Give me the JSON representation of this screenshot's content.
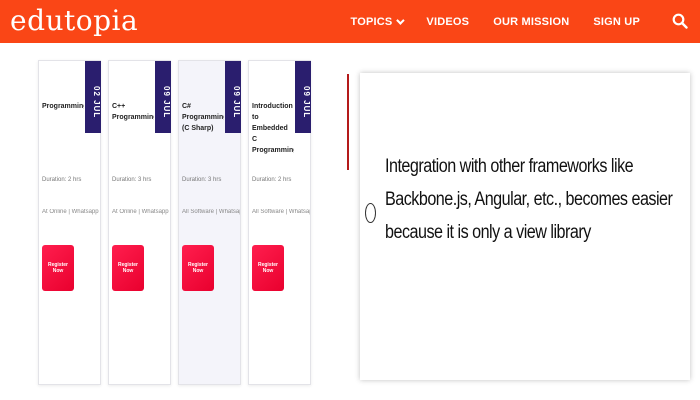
{
  "header": {
    "logo": "edutopia",
    "nav": [
      {
        "label": "TOPICS",
        "has_dropdown": true
      },
      {
        "label": "VIDEOS"
      },
      {
        "label": "OUR MISSION"
      },
      {
        "label": "SIGN UP"
      }
    ],
    "search_icon": "search-icon",
    "bg_color": "#fa4616"
  },
  "cards": [
    {
      "number": "02 JUL",
      "title": "Programming",
      "meta1": "Duration: 2 hrs",
      "meta2": "At Online | Whatsapp & Hardcopy",
      "cta": "Register Now"
    },
    {
      "number": "09 JUL",
      "title": "C++ Programming",
      "meta1": "Duration: 3 hrs",
      "meta2": "At Online | Whatsapp & Hardcopy",
      "cta": "Register Now"
    },
    {
      "number": "09 JUL",
      "title": "C# Programming (C Sharp)",
      "meta1": "Duration: 3 hrs",
      "meta2": "All Software | Whatsapp & Hardcopy",
      "cta": "Register Now"
    },
    {
      "number": "09 JUL",
      "title": "Introduction to Embedded C Programming",
      "meta1": "Duration: 2 hrs",
      "meta2": "All Software | Whatsapp & Hardcopy",
      "cta": "Register Now"
    }
  ],
  "quote": {
    "text": "Integration with other frameworks like Backbone.js, Angular, etc., becomes easier because it is only a view library"
  }
}
